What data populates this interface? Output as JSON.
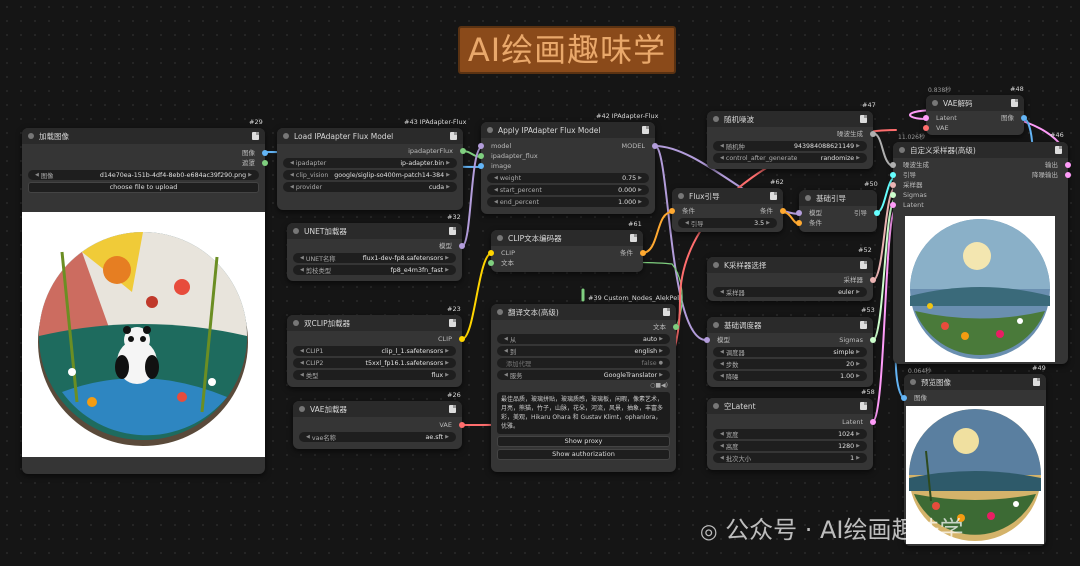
{
  "banner": {
    "title": "AI绘画趣味学"
  },
  "watermark": {
    "text": "公众号 · AI绘画趣味学"
  },
  "nodes": {
    "load_image": {
      "id": "#29",
      "title": "加载图像",
      "out1": "图像",
      "out2": "遮罩",
      "image_label": "图像",
      "image_value": "d14e70ea-151b-4df4-8eb0-e684ac39f290.png",
      "upload": "choose file to upload"
    },
    "ipadapter_loader": {
      "id": "#43 IPAdapter-Flux",
      "title": "Load IPAdapter Flux Model",
      "out": "ipadapterFlux",
      "w1l": "ipadapter",
      "w1v": "ip-adapter.bin",
      "w2l": "clip_vision",
      "w2v": "google/siglip-so400m-patch14-384",
      "w3l": "provider",
      "w3v": "cuda"
    },
    "apply_ipadapter": {
      "id": "#42 IPAdapter-Flux",
      "title": "Apply IPAdapter Flux Model",
      "in1": "model",
      "in2": "ipadapter_flux",
      "in3": "image",
      "out": "MODEL",
      "w1l": "weight",
      "w1v": "0.75",
      "w2l": "start_percent",
      "w2v": "0.000",
      "w3l": "end_percent",
      "w3v": "1.000"
    },
    "unet": {
      "id": "#32",
      "title": "UNET加载器",
      "out": "模型",
      "w1l": "UNET名称",
      "w1v": "flux1-dev-fp8.safetensors",
      "w2l": "剪枝类型",
      "w2v": "fp8_e4m3fn_fast"
    },
    "clip_encode": {
      "id": "#61",
      "title": "CLIP文本编码器",
      "in1": "CLIP",
      "in2": "文本",
      "out": "条件"
    },
    "dual_clip": {
      "id": "#23",
      "title": "双CLIP加载器",
      "out": "CLIP",
      "w1l": "CLIP1",
      "w1v": "clip_l_1.safetensors",
      "w2l": "CLIP2",
      "w2v": "t5xxl_fp16.1.safetensors",
      "w3l": "类型",
      "w3v": "flux"
    },
    "vae_loader": {
      "id": "#26",
      "title": "VAE加载器",
      "out": "VAE",
      "w1l": "vae名称",
      "w1v": "ae.sft"
    },
    "translate": {
      "id": "#39 Custom_Nodes_AlekPel",
      "title": "翻译文本(高级)",
      "out": "文本",
      "w1l": "从",
      "w1v": "auto",
      "w2l": "到",
      "w2v": "english",
      "w3l": "添加代理",
      "w3v": "false",
      "w4l": "服务",
      "w4v": "GoogleTranslator",
      "text": "最佳品质，玻璃拼贴，玻璃质感，玻璃板，闲暇，像素艺术，月亮，熊猫，竹子，山脉，花朵，河流，风景，抽象，丰富多彩，美观，Hikaru Ohara 和 Gustav Klimt，ophanlora，优雅。",
      "b1": "Show proxy",
      "b2": "Show authorization"
    },
    "flux_guide": {
      "id": "#62",
      "title": "Flux引导",
      "in": "条件",
      "out": "条件",
      "w1l": "引导",
      "w1v": "3.5"
    },
    "basic_guide": {
      "id": "#50",
      "title": "基础引导",
      "in1": "模型",
      "in2": "条件",
      "out": "引导"
    },
    "random_noise": {
      "id": "#47",
      "title": "随机噪波",
      "out": "噪波生成",
      "w1l": "随机种",
      "w1v": "943984088621149",
      "w2l": "control_after_generate",
      "w2v": "randomize"
    },
    "ksampler_select": {
      "id": "#52",
      "title": "K采样器选择",
      "out": "采样器",
      "w1l": "采样器",
      "w1v": "euler"
    },
    "basic_sched": {
      "id": "#53",
      "title": "基础调度器",
      "in": "模型",
      "out": "Sigmas",
      "w1l": "调度器",
      "w1v": "simple",
      "w2l": "步数",
      "w2v": "20",
      "w3l": "降噪",
      "w3v": "1.00"
    },
    "empty_latent": {
      "id": "#58",
      "title": "空Latent",
      "out": "Latent",
      "w1l": "宽度",
      "w1v": "1024",
      "w2l": "高度",
      "w2v": "1280",
      "w3l": "批次大小",
      "w3v": "1"
    },
    "vae_decode": {
      "id": "#48",
      "time": "0.838秒",
      "title": "VAE解码",
      "in1": "Latent",
      "in2": "VAE",
      "out": "图像"
    },
    "custom_sampler": {
      "id": "#46",
      "time": "11.026秒",
      "title": "自定义采样器(高级)",
      "in1": "噪波生成",
      "in2": "引导",
      "in3": "采样器",
      "in4": "Sigmas",
      "in5": "Latent",
      "out1": "输出",
      "out2": "降噪输出",
      "time2": "0.064秒"
    },
    "preview": {
      "id": "#49",
      "title": "预览图像",
      "in": "图像"
    }
  },
  "colors": {
    "model": "#b39ddb",
    "clip": "#ffd500",
    "vae": "#ff6e6e",
    "conditioning": "#ffa931",
    "image": "#64b5f6",
    "latent": "#ff9cf9",
    "noise": "#b0b0b0",
    "guider": "#66ffff",
    "sampler": "#ecb4b4",
    "sigmas": "#cdffcd",
    "ipadapter": "#7fcf7f",
    "string": "#7fcf7f"
  },
  "icons": [
    "node-dot-icon",
    "document-icon",
    "dropdown-arrow-icon"
  ]
}
